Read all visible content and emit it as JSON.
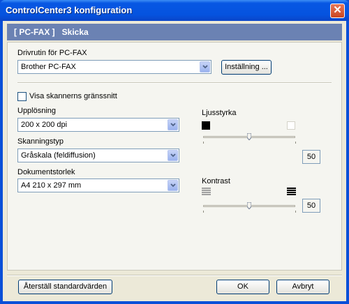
{
  "window": {
    "title": "ControlCenter3 konfiguration",
    "close_glyph": "✕"
  },
  "header": {
    "text": "[ PC-FAX ]   Skicka"
  },
  "driver": {
    "label": "Drivrutin för PC-FAX",
    "value": "Brother PC-FAX",
    "settings_button": "Inställning ..."
  },
  "scanner_ui_checkbox": {
    "label": "Visa skannerns gränssnitt",
    "checked": false
  },
  "resolution": {
    "label": "Upplösning",
    "value": "200 x 200 dpi"
  },
  "scan_type": {
    "label": "Skanningstyp",
    "value": "Gråskala (feldiffusion)"
  },
  "doc_size": {
    "label": "Dokumentstorlek",
    "value": "A4 210 x 297 mm"
  },
  "brightness": {
    "label": "Ljusstyrka",
    "value": "50",
    "level": 0.5
  },
  "contrast": {
    "label": "Kontrast",
    "value": "50",
    "level": 0.5
  },
  "footer": {
    "restore_button": "Återställ standardvärden",
    "ok_button": "OK",
    "cancel_button": "Avbryt"
  },
  "colors": {
    "titlebar": "#0757e3",
    "header": "#6b82b3",
    "dialog_bg": "#ece9d8",
    "close": "#c9451f"
  }
}
